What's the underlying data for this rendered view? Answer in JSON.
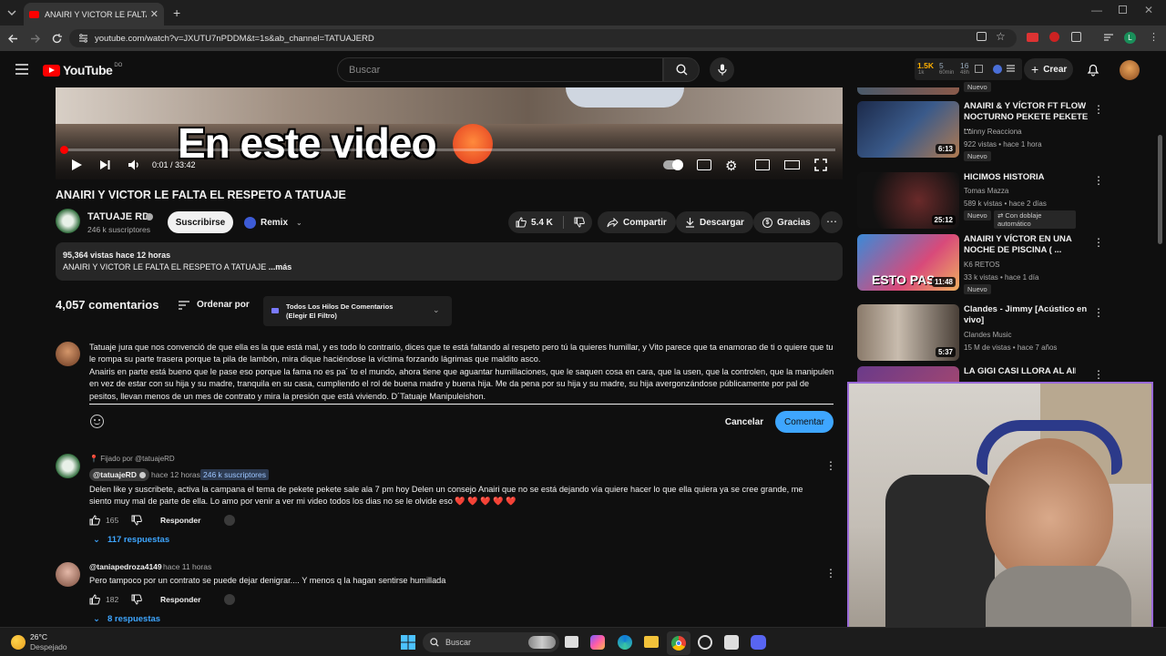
{
  "browser": {
    "tab_title": "ANAIRI Y VICTOR LE FALTA EL RE",
    "url": "youtube.com/watch?v=JXUTU7nPDDM&t=1s&ab_channel=TATUAJERD"
  },
  "header": {
    "logo": "YouTube",
    "logo_country": "DO",
    "search_placeholder": "Buscar",
    "create_label": "Crear",
    "stats": {
      "a": "1.5K",
      "a_sub": "1k",
      "b": "5",
      "b_sub": "60min",
      "c": "16",
      "c_sub": "48h"
    },
    "avatar_color": "#c97a3a"
  },
  "video": {
    "caption": "En este video",
    "time": "0:01 / 33:42",
    "title": "ANAIRI Y VICTOR LE FALTA EL RESPETO A TATUAJE",
    "progress": 0.0005
  },
  "channel": {
    "name": "TATUAJE RD",
    "subs": "246 k suscriptores",
    "subscribe_label": "Suscribirse",
    "remix_label": "Remix",
    "likes": "5.4 K",
    "share_label": "Compartir",
    "download_label": "Descargar",
    "thanks_label": "Gracias"
  },
  "description": {
    "meta": "95,364 vistas  hace 12 horas",
    "text": "ANAIRI Y VICTOR LE FALTA EL RESPETO A TATUAJE",
    "more": "...más"
  },
  "comments": {
    "count": "4,057 comentarios",
    "sort_label": "Ordenar por",
    "filter_label": "Todos Los Hilos De Comentarios",
    "filter_sub": "(Elegir El Filtro)",
    "draft_p1": "Tatuaje jura que nos convenció de que ella es la que está mal, y es todo lo contrario, dices que te está faltando al respeto pero tú la quieres humillar, y Vito parece que ta enamorao de ti o quiere que tu le rompa su parte trasera porque ta pila de lambón, mira dique haciéndose la víctima forzando lágrimas que maldito asco.",
    "draft_p2": "Anairis en parte está bueno que le pase eso porque la fama no es pa´ to el mundo, ahora tiene que aguantar humillaciones, que le saquen cosa en cara, que la usen, que la controlen, que la manipulen en vez de estar con su hija y su madre, tranquila en su casa, cumpliendo el rol de buena madre y buena hija. Me da pena por su hija y su madre, su hija avergonzándose públicamente por pal de pesitos, llevan menos de un mes de contrato y mira la presión que está viviendo. D´Tatuaje Manipuleishon.",
    "cancel_label": "Cancelar",
    "submit_label": "Comentar",
    "items": [
      {
        "pinned": "Fijado por @tatuajeRD",
        "author": "@tatuajeRD",
        "time": "hace 12 horas",
        "subs_badge": "246 k suscriptores",
        "text": "Delen like y suscribete, activa la campana el tema de pekete pekete sale ala 7 pm hoy Delen un consejo Anairi que no se está dejando vía quiere hacer lo que ella quiera ya se cree grande, me siento muy mal de parte de ella. Lo amo por venir a ver mi video todos los dias no se le olvide eso ❤️ ❤️ ❤️ ❤️ ❤️",
        "likes": "165",
        "reply_label": "Responder",
        "replies": "117 respuestas"
      },
      {
        "author": "@taniapedroza4149",
        "time": "hace 11 horas",
        "text": "Pero tampoco por un contrato se puede dejar denigrar.... Y menos q la hagan sentirse humillada",
        "likes": "182",
        "reply_label": "Responder",
        "replies": "8 respuestas"
      }
    ]
  },
  "sidebar": {
    "items": [
      {
        "badge": "Nuevo"
      },
      {
        "title": "ANAIRI & Y VÍCTOR FT FLOW NOCTURNO PEKETE PEKETE ...",
        "channel": "Luinny Reacciona",
        "meta": "922 vistas • hace 1 hora",
        "badge": "Nuevo",
        "dur": "6:13"
      },
      {
        "title": "HICIMOS HISTORIA",
        "channel": "Tomas Mazza",
        "meta": "589 k vistas • hace 2 días",
        "badge": "Nuevo",
        "badge2": "Con doblaje automático",
        "dur": "25:12"
      },
      {
        "title": "ANAIRI Y VÍCTOR EN UNA NOCHE DE PISCINA ( ...",
        "channel": "K6 RETOS",
        "meta": "33 k vistas • hace 1 día",
        "badge": "Nuevo",
        "dur": "11:48",
        "thumb_text": "ESTO PAS"
      },
      {
        "title": "Clandes - Jimmy [Acústico en vivo]",
        "channel": "Clandes Music",
        "meta": "15 M de vistas • hace 7 años",
        "dur": "5:37"
      },
      {
        "title": "LA GIGI CASI LLORA AL AIRE"
      }
    ]
  },
  "taskbar": {
    "temp": "26°C",
    "weather": "Despejado",
    "search_label": "Buscar"
  }
}
